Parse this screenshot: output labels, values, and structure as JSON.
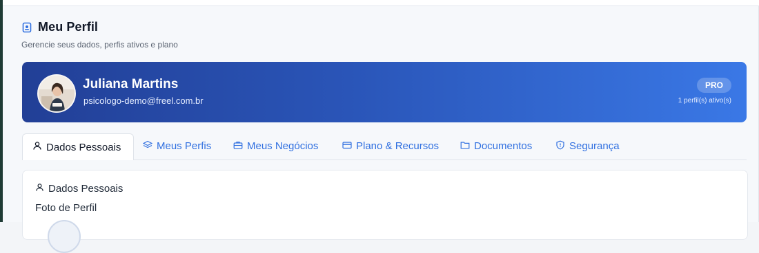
{
  "header": {
    "title": "Meu Perfil",
    "subtitle": "Gerencie seus dados, perfis ativos e plano"
  },
  "banner": {
    "name": "Juliana Martins",
    "email": "psicologo-demo@freel.com.br",
    "badge": "PRO",
    "profiles_active": "1 perfil(s) ativo(s)"
  },
  "tabs": [
    {
      "label": "Dados Pessoais",
      "icon": "user-icon",
      "active": true
    },
    {
      "label": "Meus Perfis",
      "icon": "layers-icon",
      "active": false
    },
    {
      "label": "Meus Negócios",
      "icon": "briefcase-icon",
      "active": false
    },
    {
      "label": "Plano & Recursos",
      "icon": "credit-card-icon",
      "active": false
    },
    {
      "label": "Documentos",
      "icon": "folder-icon",
      "active": false
    },
    {
      "label": "Segurança",
      "icon": "shield-icon",
      "active": false
    }
  ],
  "section": {
    "title": "Dados Pessoais",
    "photo_label": "Foto de Perfil"
  },
  "colors": {
    "accent": "#2f6fe0",
    "banner_start": "#223f96",
    "banner_end": "#3a78e6"
  }
}
